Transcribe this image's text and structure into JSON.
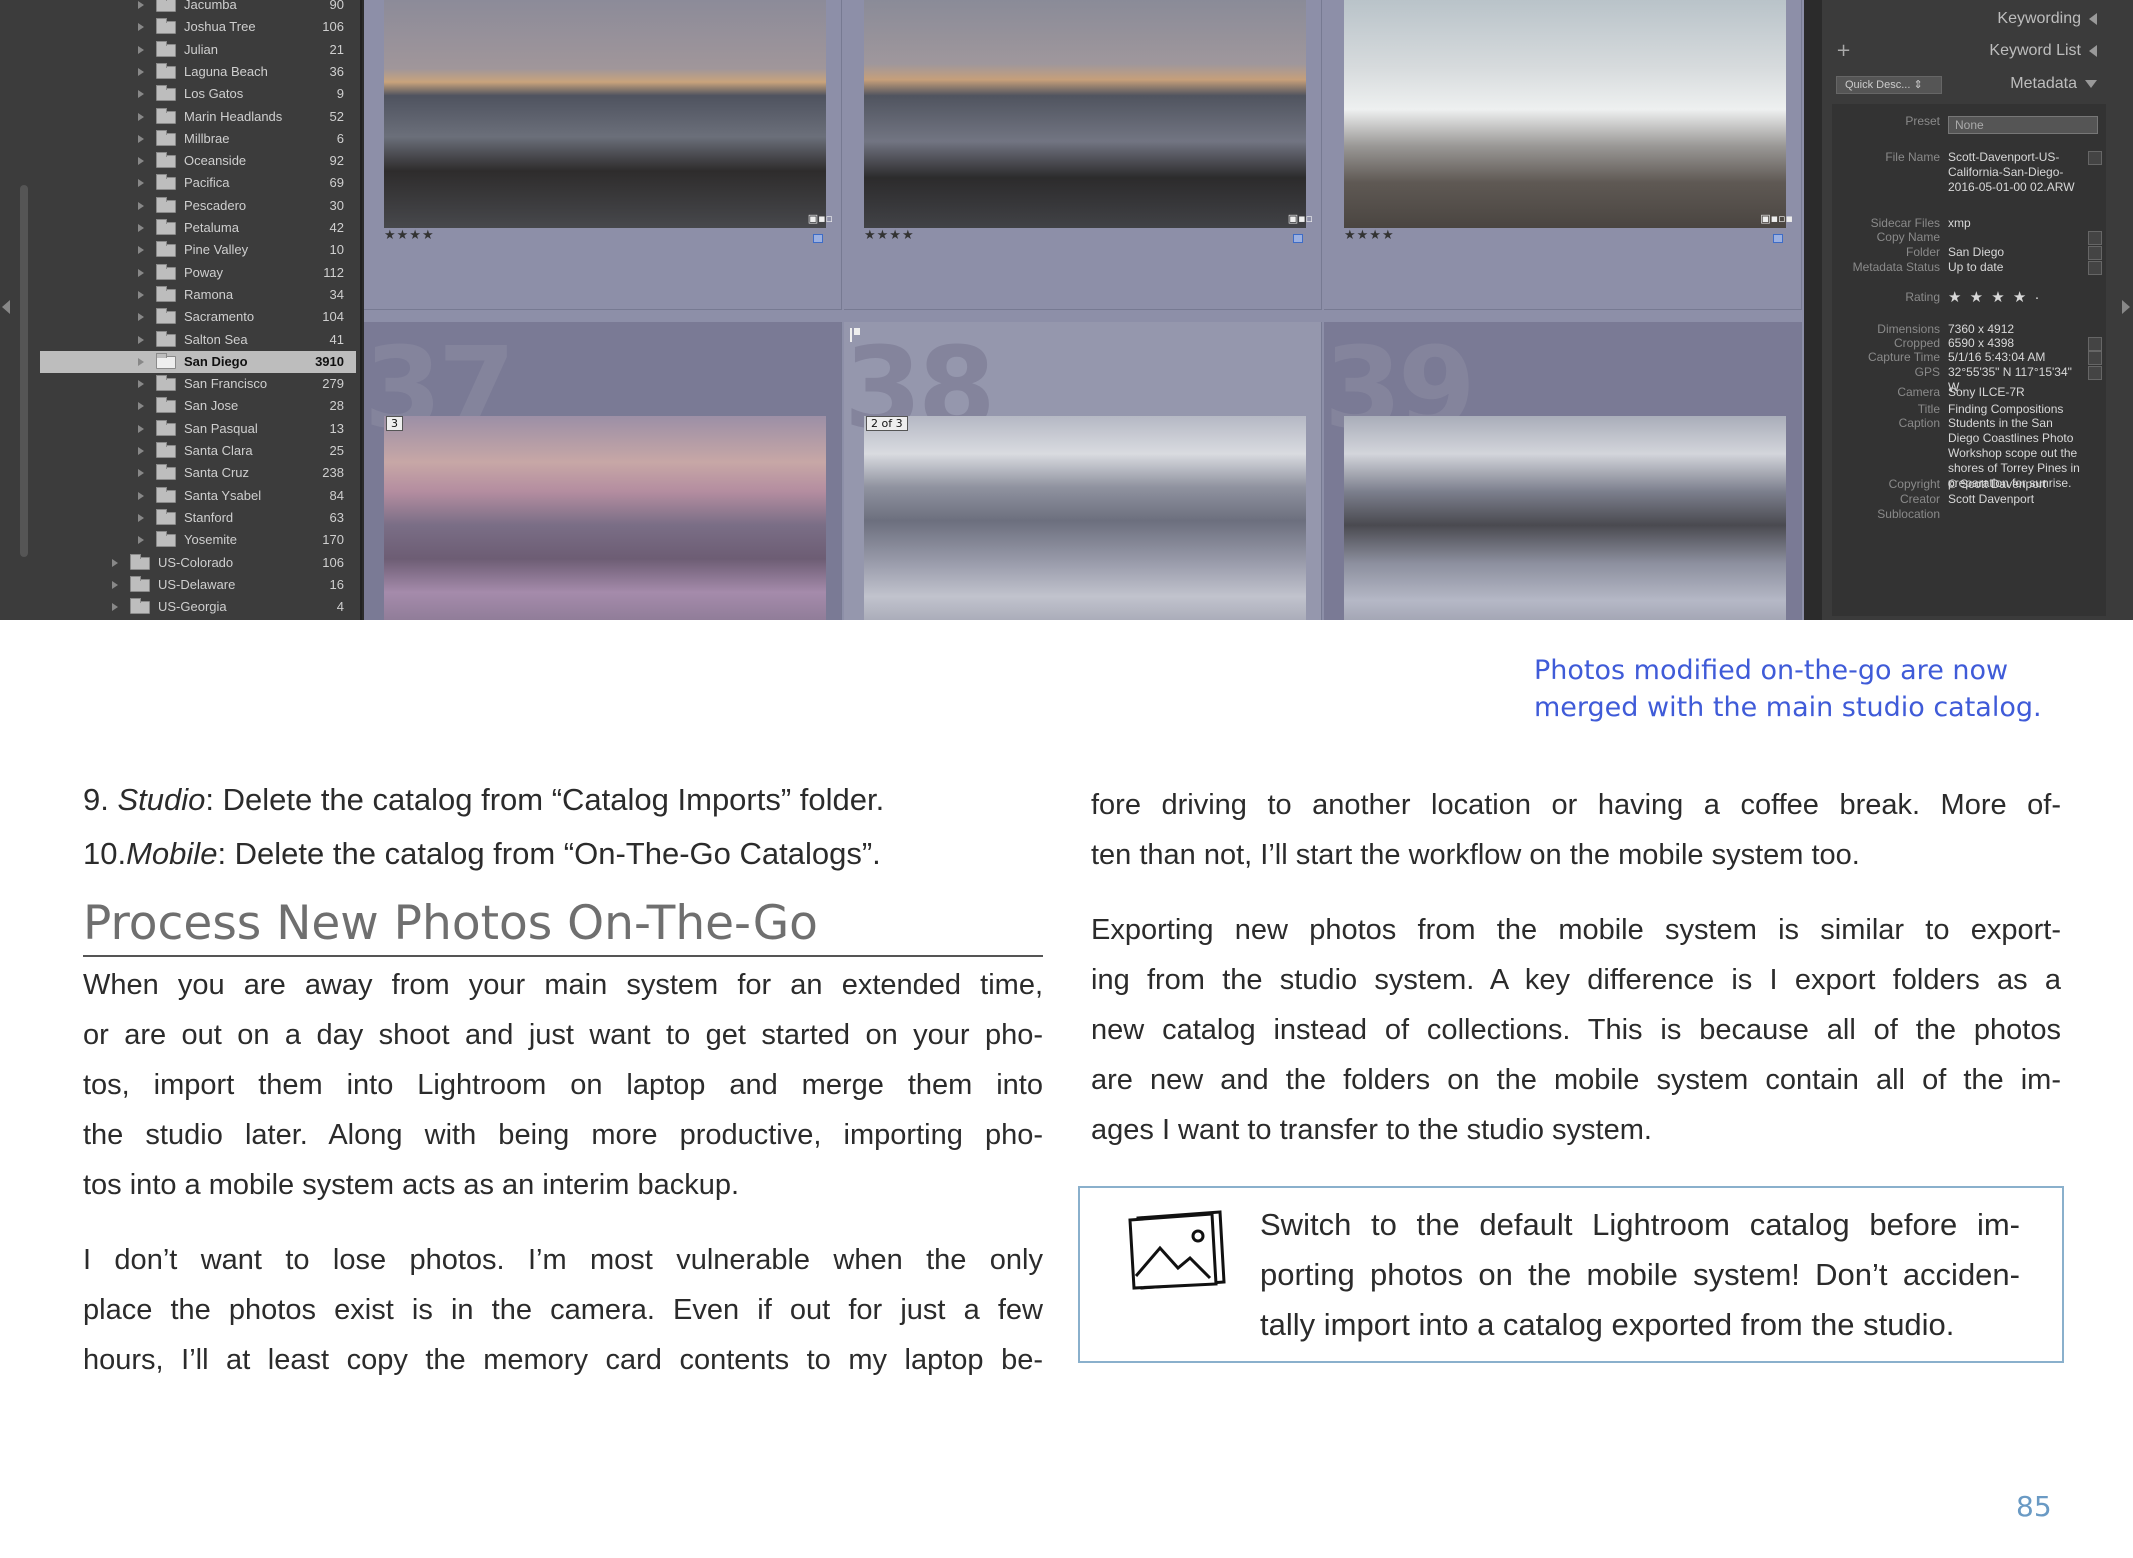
{
  "screenshot": {
    "folders": [
      {
        "name": "Jacumba",
        "count": "90"
      },
      {
        "name": "Joshua Tree",
        "count": "106"
      },
      {
        "name": "Julian",
        "count": "21"
      },
      {
        "name": "Laguna Beach",
        "count": "36"
      },
      {
        "name": "Los Gatos",
        "count": "9"
      },
      {
        "name": "Marin Headlands",
        "count": "52"
      },
      {
        "name": "Millbrae",
        "count": "6"
      },
      {
        "name": "Oceanside",
        "count": "92"
      },
      {
        "name": "Pacifica",
        "count": "69"
      },
      {
        "name": "Pescadero",
        "count": "30"
      },
      {
        "name": "Petaluma",
        "count": "42"
      },
      {
        "name": "Pine Valley",
        "count": "10"
      },
      {
        "name": "Poway",
        "count": "112"
      },
      {
        "name": "Ramona",
        "count": "34"
      },
      {
        "name": "Sacramento",
        "count": "104"
      },
      {
        "name": "Salton Sea",
        "count": "41"
      },
      {
        "name": "San Diego",
        "count": "3910",
        "selected": true
      },
      {
        "name": "San Francisco",
        "count": "279"
      },
      {
        "name": "San Jose",
        "count": "28"
      },
      {
        "name": "San Pasqual",
        "count": "13"
      },
      {
        "name": "Santa Clara",
        "count": "25"
      },
      {
        "name": "Santa Cruz",
        "count": "238"
      },
      {
        "name": "Santa Ysabel",
        "count": "84"
      },
      {
        "name": "Stanford",
        "count": "63"
      },
      {
        "name": "Yosemite",
        "count": "170"
      },
      {
        "name": "US-Colorado",
        "count": "106",
        "top": true
      },
      {
        "name": "US-Delaware",
        "count": "16",
        "top": true
      },
      {
        "name": "US-Georgia",
        "count": "4",
        "top": true
      }
    ],
    "grid": {
      "top_stars": [
        "★★★★",
        "★★★★",
        "★★★★"
      ],
      "cell_numbers": [
        "37",
        "38",
        "39"
      ],
      "badges": [
        "3",
        "2 of 3"
      ]
    },
    "panel": {
      "keywording": "Keywording",
      "keyword_list": "Keyword List",
      "quick_desc": "Quick Desc...",
      "metadata": "Metadata",
      "preset_label": "Preset",
      "preset_value": "None",
      "fields": [
        {
          "label": "File Name",
          "value": "Scott-Davenport-US-California-San-Diego-2016-05-01-00 02.ARW"
        },
        {
          "label": "Sidecar Files",
          "value": "xmp"
        },
        {
          "label": "Copy Name",
          "value": ""
        },
        {
          "label": "Folder",
          "value": "San Diego"
        },
        {
          "label": "Metadata Status",
          "value": "Up to date"
        },
        {
          "label": "Rating",
          "value": "★ ★ ★ ★ ·"
        },
        {
          "label": "Dimensions",
          "value": "7360 x 4912"
        },
        {
          "label": "Cropped",
          "value": "6590 x 4398"
        },
        {
          "label": "Capture Time",
          "value": "5/1/16 5:43:04 AM"
        },
        {
          "label": "GPS",
          "value": "32°55'35\" N 117°15'34\" W"
        },
        {
          "label": "Camera",
          "value": "Sony ILCE-7R"
        },
        {
          "label": "Title",
          "value": "Finding Compositions"
        },
        {
          "label": "Caption",
          "value": "Students in the San Diego Coastlines Photo Workshop scope out the shores of Torrey Pines in preparation for sunrise."
        },
        {
          "label": "Copyright",
          "value": "© Scott Davenport"
        },
        {
          "label": "Creator",
          "value": "Scott Davenport"
        },
        {
          "label": "Sublocation",
          "value": ""
        }
      ]
    }
  },
  "caption": [
    "Photos modified on-the-go are now",
    "merged with the main studio catalog."
  ],
  "steps": [
    {
      "num": "9. ",
      "role": "Studio",
      "text": ": Delete the catalog from “Catalog Imports” folder."
    },
    {
      "num": "10.",
      "role": "Mobile",
      "text": ": Delete the catalog from “On-The-Go Catalogs”."
    }
  ],
  "heading": "Process New Photos On-The-Go",
  "left_paragraphs": [
    [
      "When you are away from your main system for an extended time,",
      "or are out on a day shoot and just want to get started on your pho-",
      "tos, import them into Lightroom on laptop and merge them into",
      "the studio later. Along with being more productive, importing pho-",
      "tos into a mobile system acts as an interim backup."
    ],
    [
      "I don’t want to lose photos. I’m most vulnerable when the only",
      "place the photos exist is in the camera. Even if out for just a few",
      "hours, I’ll at least copy the memory card contents to my laptop be-"
    ]
  ],
  "right_paragraphs": [
    [
      "fore driving to another location or having a coffee break. More of-",
      "ten than not, I’ll start the workflow on the mobile system too."
    ],
    [
      "Exporting new photos from the mobile system is similar to export-",
      "ing from the studio system. A key difference is I export folders as a",
      "new catalog instead of collections. This is because all of the photos",
      "are new and the folders on the mobile system contain all of the im-",
      "ages I want to transfer to the studio system."
    ]
  ],
  "tip": [
    "Switch to the default Lightroom catalog before im-",
    "porting photos on the mobile system! Don’t acciden-",
    "tally import into a catalog exported from the studio."
  ],
  "page_number": "85"
}
